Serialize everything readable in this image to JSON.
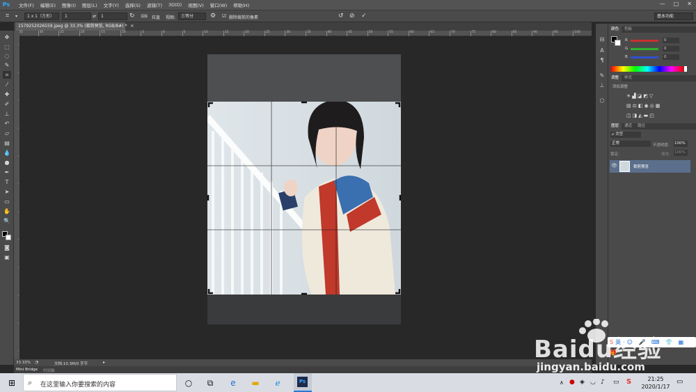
{
  "app": {
    "logo": "Ps",
    "menu": [
      "文件(F)",
      "编辑(E)",
      "图像(I)",
      "图层(L)",
      "文字(Y)",
      "选择(S)",
      "滤镜(T)",
      "3D(D)",
      "视图(V)",
      "窗口(W)",
      "帮助(H)"
    ],
    "window_controls": [
      "—",
      "□",
      "✕"
    ]
  },
  "options_bar": {
    "ratio_select": "1 x 1（方形）",
    "width_value": "1",
    "swap_label": "⇄",
    "height_value": "1",
    "clear_label": "清除",
    "straighten_label": "拉直",
    "view_label": "视图:",
    "view_select": "三等分",
    "delete_pixels_checkbox": "删除裁剪的像素",
    "workspace_select": "基本功能"
  },
  "document": {
    "tab_title": "1579252026559.jpeg @ 33.3% (裁剪预览, RGB/8#) *",
    "tab_close": "×",
    "ruler_ticks": [
      "35",
      "30",
      "25",
      "20",
      "15",
      "10",
      "5",
      "0",
      "5",
      "10",
      "15",
      "20",
      "25",
      "30",
      "35",
      "40",
      "45",
      "50",
      "55",
      "60",
      "65",
      "70",
      "75",
      "80",
      "85",
      "90",
      "95",
      "100"
    ],
    "zoom": "33.33%",
    "doc_info": "文档:10.3M/0 字节"
  },
  "bottom_panel": {
    "tabs": [
      "Mini Bridge",
      "时间轴"
    ]
  },
  "panels": {
    "color": {
      "tabs": [
        "颜色",
        "色板"
      ],
      "channels": [
        {
          "label": "R",
          "value": "0"
        },
        {
          "label": "G",
          "value": "0"
        },
        {
          "label": "B",
          "value": "0"
        }
      ]
    },
    "adjustments": {
      "tabs": [
        "调整",
        "样式"
      ],
      "heading": "添加调整"
    },
    "layers": {
      "tabs": [
        "图层",
        "通道",
        "路径"
      ],
      "kind_label": "ρ 类型",
      "blend_mode": "正常",
      "opacity_label": "不透明度:",
      "opacity_value": "100%",
      "lock_label": "锁定:",
      "fill_label": "填充:",
      "fill_value": "100%",
      "layer_name": "裁剪预览"
    }
  },
  "taskbar": {
    "search_placeholder": "在这里输入你要搜索的内容",
    "time": "21:25",
    "date": "2020/1/17",
    "ime_label": "英"
  },
  "watermark": {
    "brand": "Baidu经验",
    "url": "jingyan.baidu.com"
  },
  "colors": {
    "ps_blue": "#31a8ff",
    "layer_selected": "#5b6f8c",
    "red_slider": "#c83030",
    "green_slider": "#30b030",
    "blue_slider": "#3050d0"
  }
}
